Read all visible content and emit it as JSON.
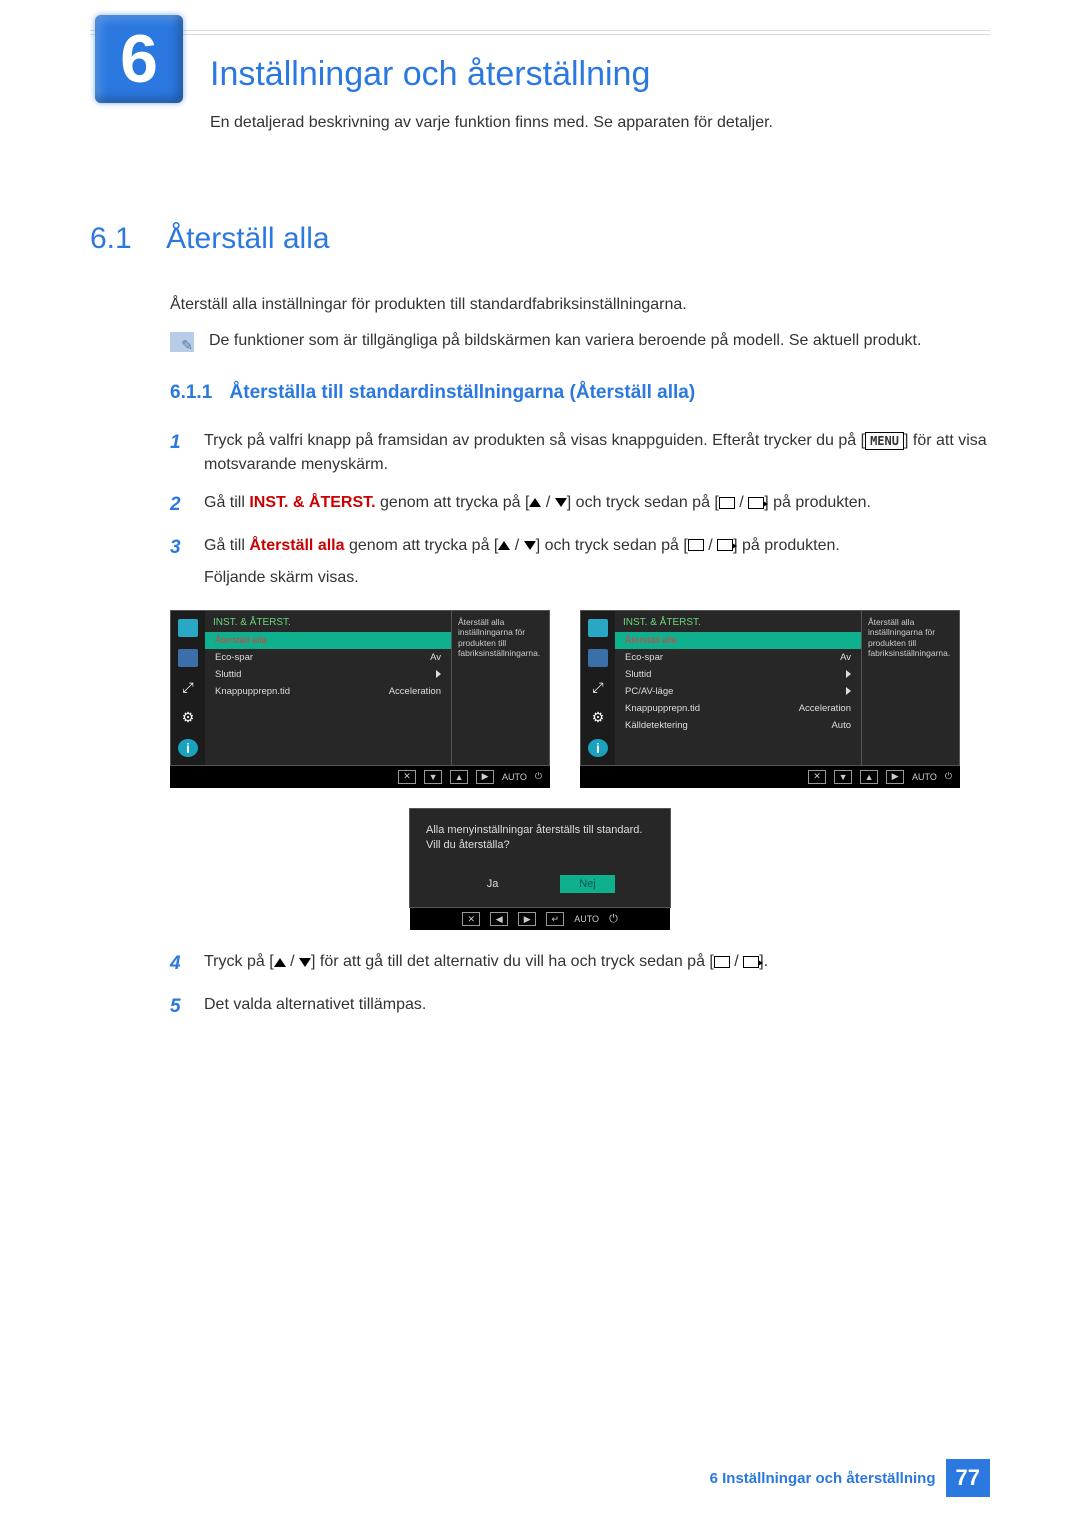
{
  "header": {
    "badge_number": "6",
    "title": "Inställningar och återställning",
    "subtitle": "En detaljerad beskrivning av varje funktion finns med. Se apparaten för detaljer."
  },
  "section_6_1": {
    "number": "6.1",
    "title": "Återställ alla",
    "intro": "Återställ alla inställningar för produkten till standardfabriksinställningarna.",
    "note": "De funktioner som är tillgängliga på bildskärmen kan variera beroende på modell. Se aktuell produkt."
  },
  "section_6_1_1": {
    "number": "6.1.1",
    "title": "Återställa till standardinställningarna (Återställ alla)"
  },
  "steps": {
    "s1_a": "Tryck på valfri knapp på framsidan av produkten så visas knappguiden. Efteråt trycker du på [",
    "s1_menu": "MENU",
    "s1_b": "] för att visa motsvarande menyskärm.",
    "s2_a": "Gå till ",
    "s2_bold": "INST. & ÅTERST.",
    "s2_b": " genom att trycka på [",
    "s2_c": "] och tryck sedan på [",
    "s2_d": "] på produkten.",
    "s3_a": "Gå till ",
    "s3_bold": "Återställ alla",
    "s3_b": " genom att trycka på [",
    "s3_c": "] och tryck sedan på [",
    "s3_d": "] på produkten.",
    "s3_follow": "Följande skärm visas.",
    "s4_a": "Tryck på [",
    "s4_b": "] för att gå till det alternativ du vill ha och tryck sedan på [",
    "s4_c": "].",
    "s5": "Det valda alternativet tillämpas."
  },
  "osd_left": {
    "title": "INST. & ÅTERST.",
    "items": [
      {
        "label": "Återställ alla",
        "value": "",
        "selected": true
      },
      {
        "label": "Eco-spar",
        "value": "Av"
      },
      {
        "label": "Sluttid",
        "value": "▶"
      },
      {
        "label": "Knappupprepn.tid",
        "value": "Acceleration"
      }
    ],
    "desc": "Återställ alla inställningarna för produkten till fabriksinställningarna."
  },
  "osd_right": {
    "title": "INST. & ÅTERST.",
    "items": [
      {
        "label": "Återställ alla",
        "value": "",
        "selected": true
      },
      {
        "label": "Eco-spar",
        "value": "Av"
      },
      {
        "label": "Sluttid",
        "value": "▶"
      },
      {
        "label": "PC/AV-läge",
        "value": "▶"
      },
      {
        "label": "Knappupprepn.tid",
        "value": "Acceleration"
      },
      {
        "label": "Källdetektering",
        "value": "Auto"
      }
    ],
    "desc": "Återställ alla inställningarna för produkten till fabriksinställningarna."
  },
  "osd_dialog": {
    "line1": "Alla menyinställningar återställs till standard.",
    "line2": "Vill du återställa?",
    "yes": "Ja",
    "no": "Nej"
  },
  "osd_footer": {
    "auto": "AUTO"
  },
  "footer": {
    "chapter": "6 Inställningar och återställning",
    "page": "77"
  }
}
